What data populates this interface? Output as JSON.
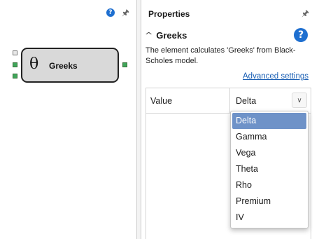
{
  "canvas": {
    "node": {
      "symbol": "θ",
      "label": "Greeks"
    }
  },
  "properties": {
    "title": "Properties",
    "section_title": "Greeks",
    "description": "The element calculates 'Greeks' from Black-Scholes model.",
    "advanced_link": "Advanced settings",
    "row": {
      "label": "Value",
      "selected_value": "Delta"
    },
    "options": [
      "Delta",
      "Gamma",
      "Vega",
      "Theta",
      "Rho",
      "Premium",
      "IV"
    ],
    "selected_option_index": 0
  },
  "icons": {
    "help": "help-icon",
    "pin": "pin-icon",
    "collapse": "chevron-up-icon",
    "dropdown": "chevron-down-icon"
  },
  "colors": {
    "help_blue": "#1e6fd0",
    "port_green": "#3fa65a",
    "link_blue": "#1a5fb4",
    "selection": "#6e92c8"
  }
}
